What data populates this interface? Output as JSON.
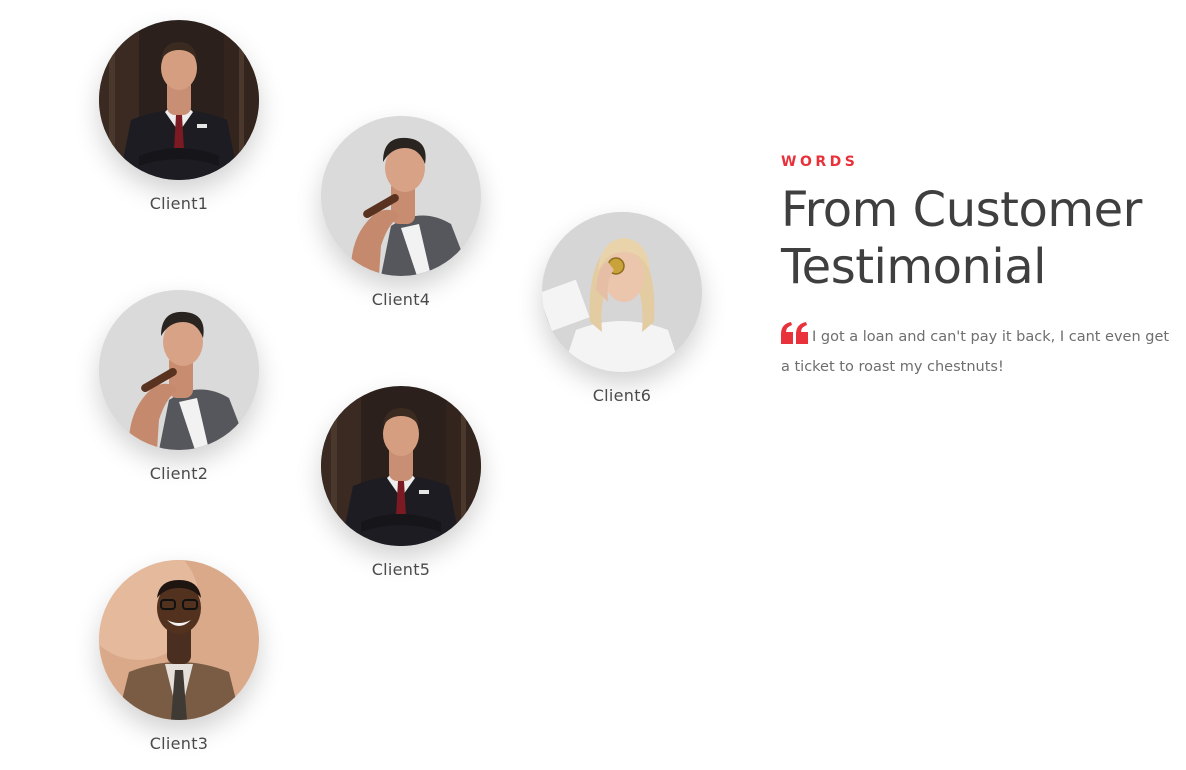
{
  "clients": [
    {
      "id": "c1",
      "name": "Client1",
      "photo": "man-dark-suit-red-tie"
    },
    {
      "id": "c2",
      "name": "Client2",
      "photo": "man-grey-blazer-cigar"
    },
    {
      "id": "c3",
      "name": "Client3",
      "photo": "man-glasses-tweed-jacket"
    },
    {
      "id": "c4",
      "name": "Client4",
      "photo": "man-grey-blazer-cigar"
    },
    {
      "id": "c5",
      "name": "Client5",
      "photo": "man-dark-suit-red-tie"
    },
    {
      "id": "c6",
      "name": "Client6",
      "photo": "woman-blonde-holding-coin"
    }
  ],
  "section": {
    "eyebrow": "WORDS",
    "heading_line1": "From Customer",
    "heading_line2": "Testimonial",
    "quote_icon": "quote-left-icon",
    "quote_text": "I got a loan and can't pay it back, I cant even get a ticket to roast my chestnuts!"
  },
  "colors": {
    "accent": "#e8313b",
    "heading": "#3f3f3f",
    "body_text": "#6e6e6e",
    "name_text": "#4a4a4a"
  }
}
